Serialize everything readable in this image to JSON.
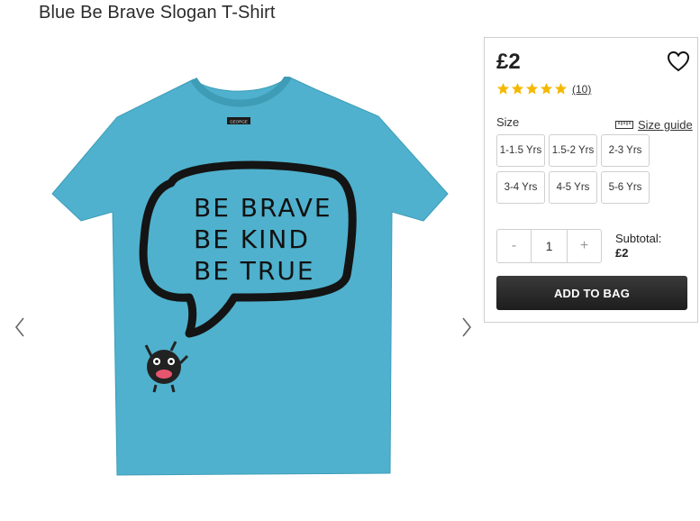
{
  "product": {
    "title": "Blue Be Brave Slogan T-Shirt",
    "shirt_text": [
      "BE BRAVE",
      "BE KIND",
      "BE TRUE"
    ],
    "label_text": "GEORGE",
    "shirt_color": "#4fb1cd"
  },
  "panel": {
    "price": "£2",
    "rating": 5,
    "review_count": "(10)",
    "size_label": "Size",
    "size_guide_label": "Size guide",
    "sizes": [
      "1-1.5 Yrs",
      "1.5-2 Yrs",
      "2-3 Yrs",
      "3-4 Yrs",
      "4-5 Yrs",
      "5-6 Yrs"
    ],
    "quantity": {
      "minus": "-",
      "value": "1",
      "plus": "+"
    },
    "subtotal_label": "Subtotal:",
    "subtotal_value": "£2",
    "add_to_bag_label": "ADD TO BAG",
    "star_color": "#f5b800"
  },
  "icons": {
    "prev": "chevron-left-icon",
    "next": "chevron-right-icon",
    "wishlist": "heart-icon",
    "size_guide": "ruler-icon"
  }
}
